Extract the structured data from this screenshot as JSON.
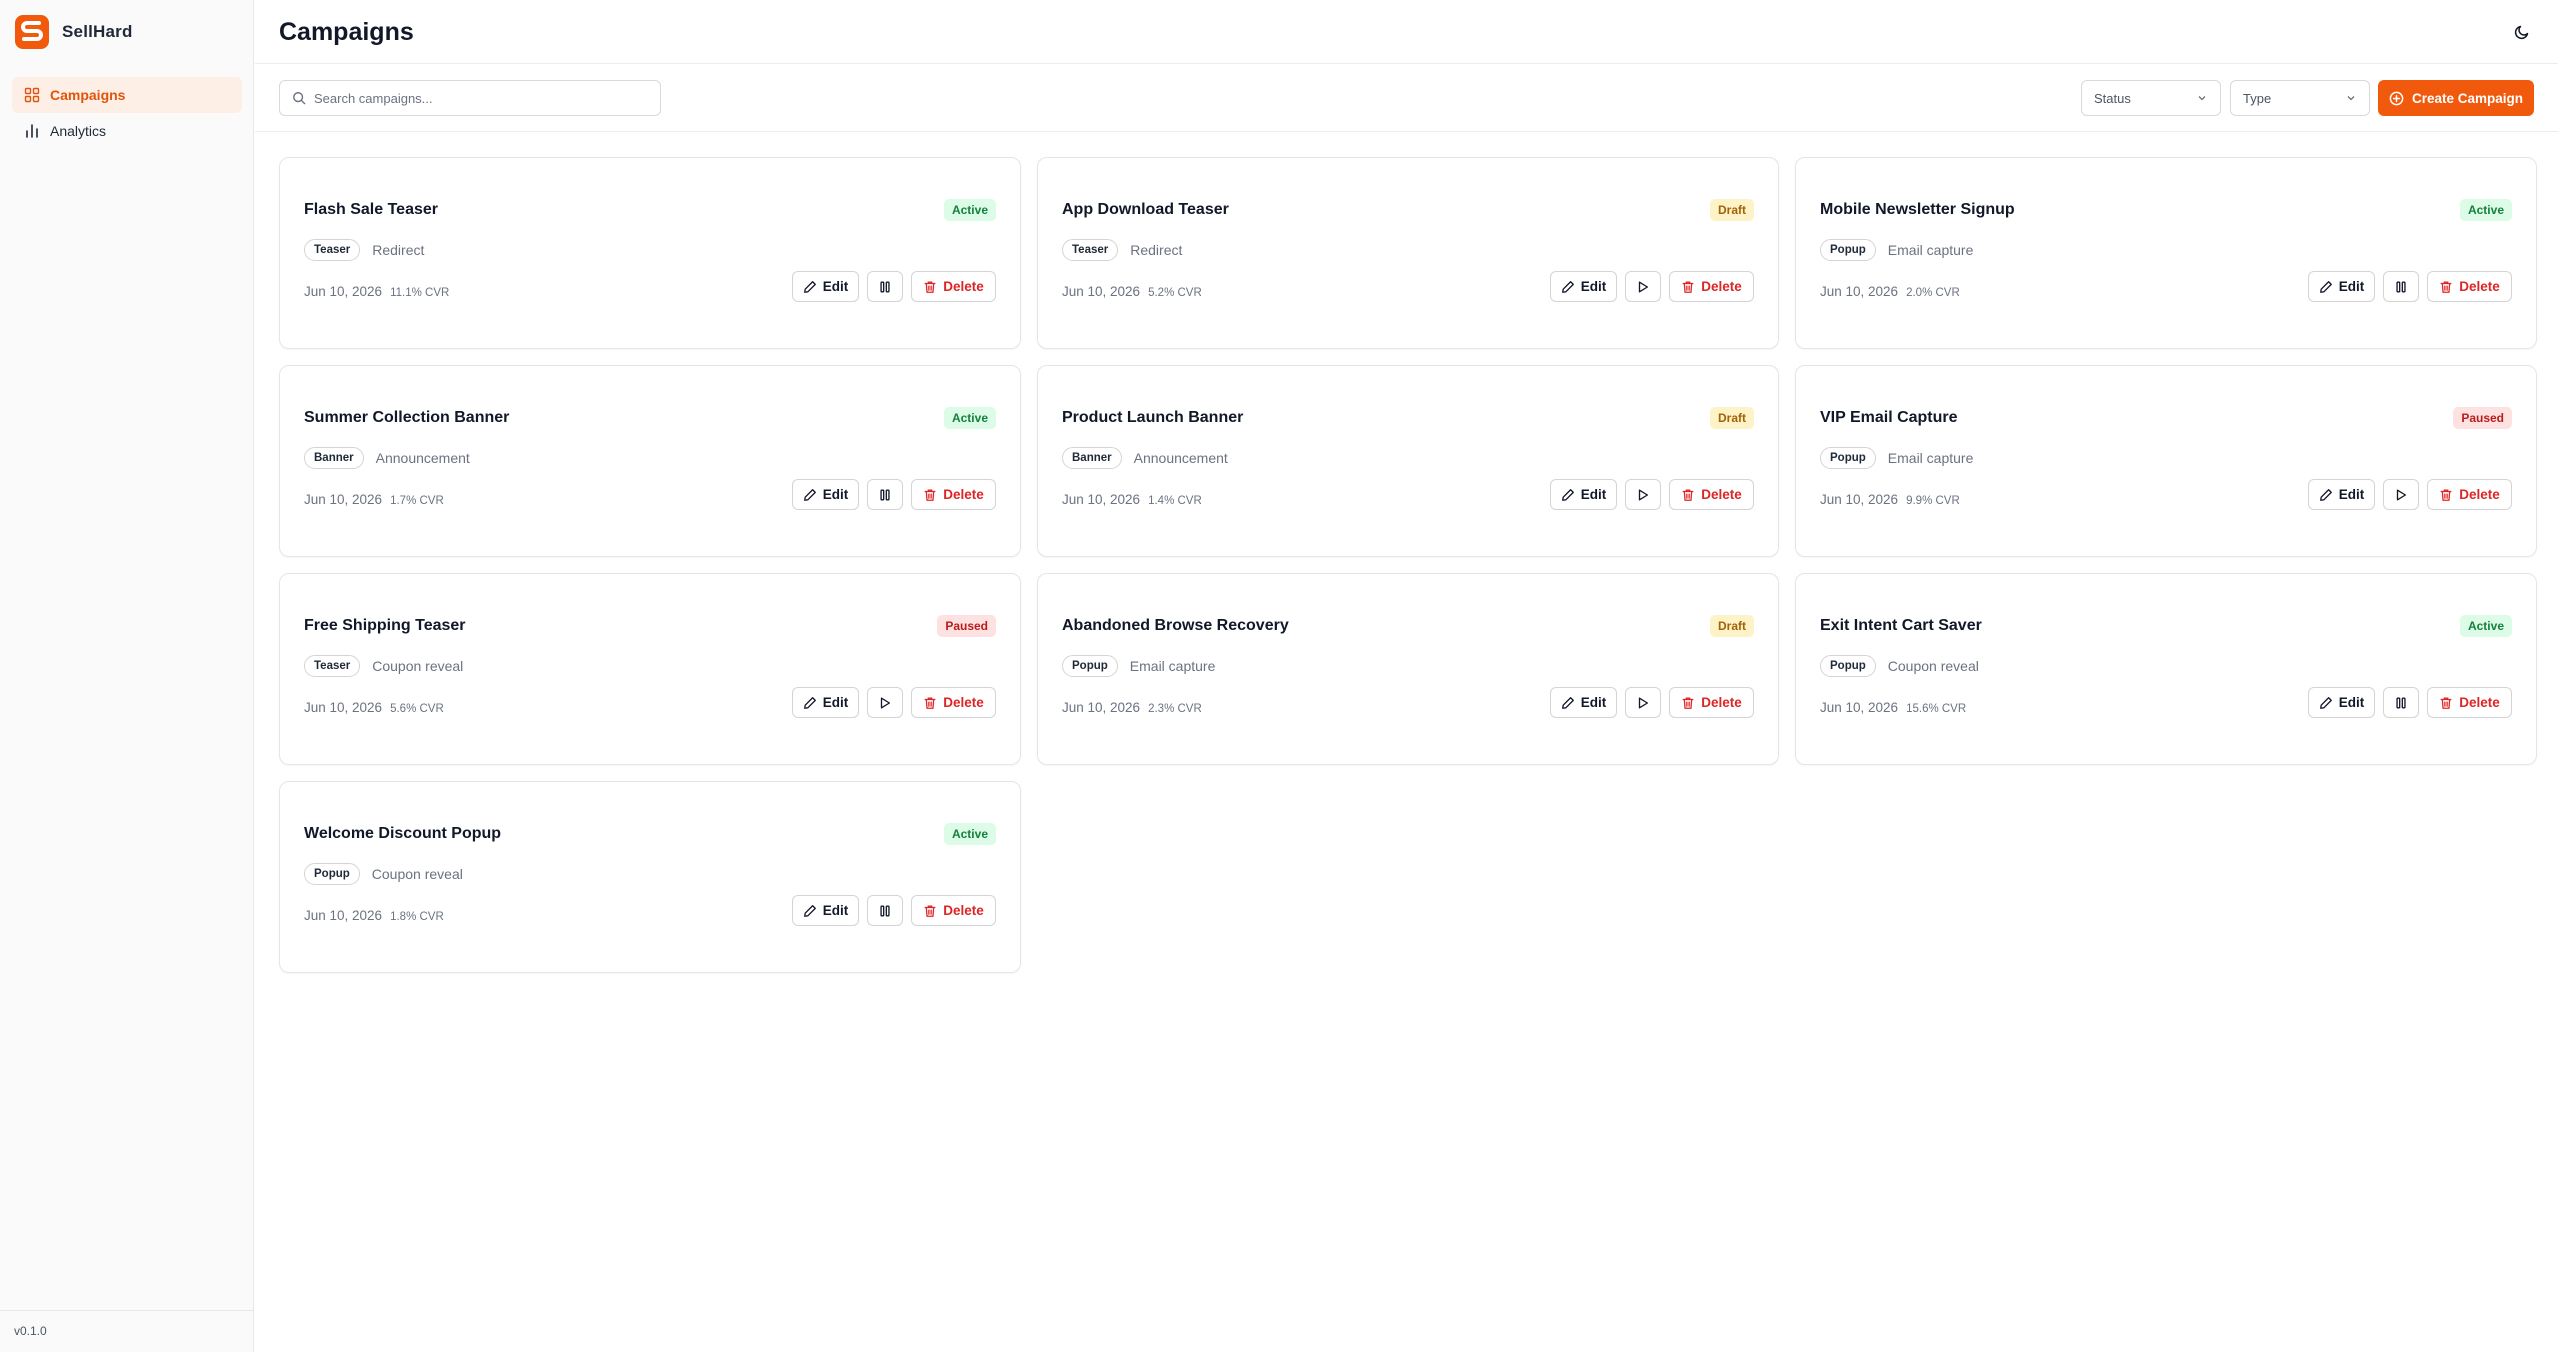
{
  "app": {
    "name": "SellHard",
    "version": "v0.1.0",
    "accent": "#f15a0c"
  },
  "sidebar": {
    "items": [
      {
        "label": "Campaigns",
        "icon": "grid-icon",
        "active": true
      },
      {
        "label": "Analytics",
        "icon": "bar-chart-icon",
        "active": false
      }
    ]
  },
  "header": {
    "title": "Campaigns",
    "theme_icon": "moon-icon"
  },
  "toolbar": {
    "search_placeholder": "Search campaigns...",
    "status_filter": "Status",
    "type_filter": "Type",
    "create_label": "Create Campaign"
  },
  "actions": {
    "edit_label": "Edit",
    "delete_label": "Delete"
  },
  "campaigns": [
    {
      "title": "Flash Sale Teaser",
      "status": "Active",
      "status_key": "active",
      "type": "Teaser",
      "goal": "Redirect",
      "date": "Jun 10, 2026",
      "cvr": "11.1% CVR",
      "toggle": "pause"
    },
    {
      "title": "App Download Teaser",
      "status": "Draft",
      "status_key": "draft",
      "type": "Teaser",
      "goal": "Redirect",
      "date": "Jun 10, 2026",
      "cvr": "5.2% CVR",
      "toggle": "play"
    },
    {
      "title": "Mobile Newsletter Signup",
      "status": "Active",
      "status_key": "active",
      "type": "Popup",
      "goal": "Email capture",
      "date": "Jun 10, 2026",
      "cvr": "2.0% CVR",
      "toggle": "pause"
    },
    {
      "title": "Summer Collection Banner",
      "status": "Active",
      "status_key": "active",
      "type": "Banner",
      "goal": "Announcement",
      "date": "Jun 10, 2026",
      "cvr": "1.7% CVR",
      "toggle": "pause"
    },
    {
      "title": "Product Launch Banner",
      "status": "Draft",
      "status_key": "draft",
      "type": "Banner",
      "goal": "Announcement",
      "date": "Jun 10, 2026",
      "cvr": "1.4% CVR",
      "toggle": "play"
    },
    {
      "title": "VIP Email Capture",
      "status": "Paused",
      "status_key": "paused",
      "type": "Popup",
      "goal": "Email capture",
      "date": "Jun 10, 2026",
      "cvr": "9.9% CVR",
      "toggle": "play"
    },
    {
      "title": "Free Shipping Teaser",
      "status": "Paused",
      "status_key": "paused",
      "type": "Teaser",
      "goal": "Coupon reveal",
      "date": "Jun 10, 2026",
      "cvr": "5.6% CVR",
      "toggle": "play"
    },
    {
      "title": "Abandoned Browse Recovery",
      "status": "Draft",
      "status_key": "draft",
      "type": "Popup",
      "goal": "Email capture",
      "date": "Jun 10, 2026",
      "cvr": "2.3% CVR",
      "toggle": "play"
    },
    {
      "title": "Exit Intent Cart Saver",
      "status": "Active",
      "status_key": "active",
      "type": "Popup",
      "goal": "Coupon reveal",
      "date": "Jun 10, 2026",
      "cvr": "15.6% CVR",
      "toggle": "pause"
    },
    {
      "title": "Welcome Discount Popup",
      "status": "Active",
      "status_key": "active",
      "type": "Popup",
      "goal": "Coupon reveal",
      "date": "Jun 10, 2026",
      "cvr": "1.8% CVR",
      "toggle": "pause"
    }
  ]
}
